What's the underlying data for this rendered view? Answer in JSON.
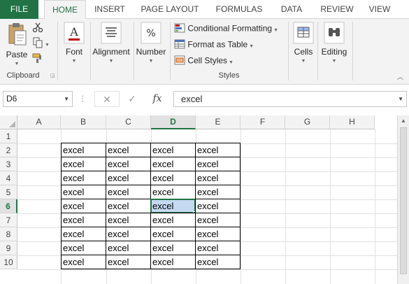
{
  "ribbon_tabs": [
    "FILE",
    "HOME",
    "INSERT",
    "PAGE LAYOUT",
    "FORMULAS",
    "DATA",
    "REVIEW",
    "VIEW"
  ],
  "active_tab": "HOME",
  "clipboard": {
    "paste_label": "Paste",
    "group_label": "Clipboard",
    "cut_icon": "scissors-icon",
    "copy_icon": "copy-icon",
    "format_painter_icon": "paintbrush-icon"
  },
  "font": {
    "label": "Font"
  },
  "alignment": {
    "label": "Alignment"
  },
  "number": {
    "label": "Number"
  },
  "styles": {
    "conditional_formatting": "Conditional Formatting",
    "format_as_table": "Format as Table",
    "cell_styles": "Cell Styles",
    "group_label": "Styles"
  },
  "cells": {
    "label": "Cells"
  },
  "editing": {
    "label": "Editing"
  },
  "formula_bar": {
    "name_box": "D6",
    "cancel_icon": "✕",
    "enter_icon": "✓",
    "fx_label": "fx",
    "formula_value": "excel"
  },
  "columns": [
    "A",
    "B",
    "C",
    "D",
    "E",
    "F",
    "G",
    "H"
  ],
  "rows": [
    "1",
    "2",
    "3",
    "4",
    "5",
    "6",
    "7",
    "8",
    "9",
    "10"
  ],
  "active_cell": "D6",
  "cell_value": "excel",
  "data_range": "B2:E10",
  "accent_color": "#217346"
}
